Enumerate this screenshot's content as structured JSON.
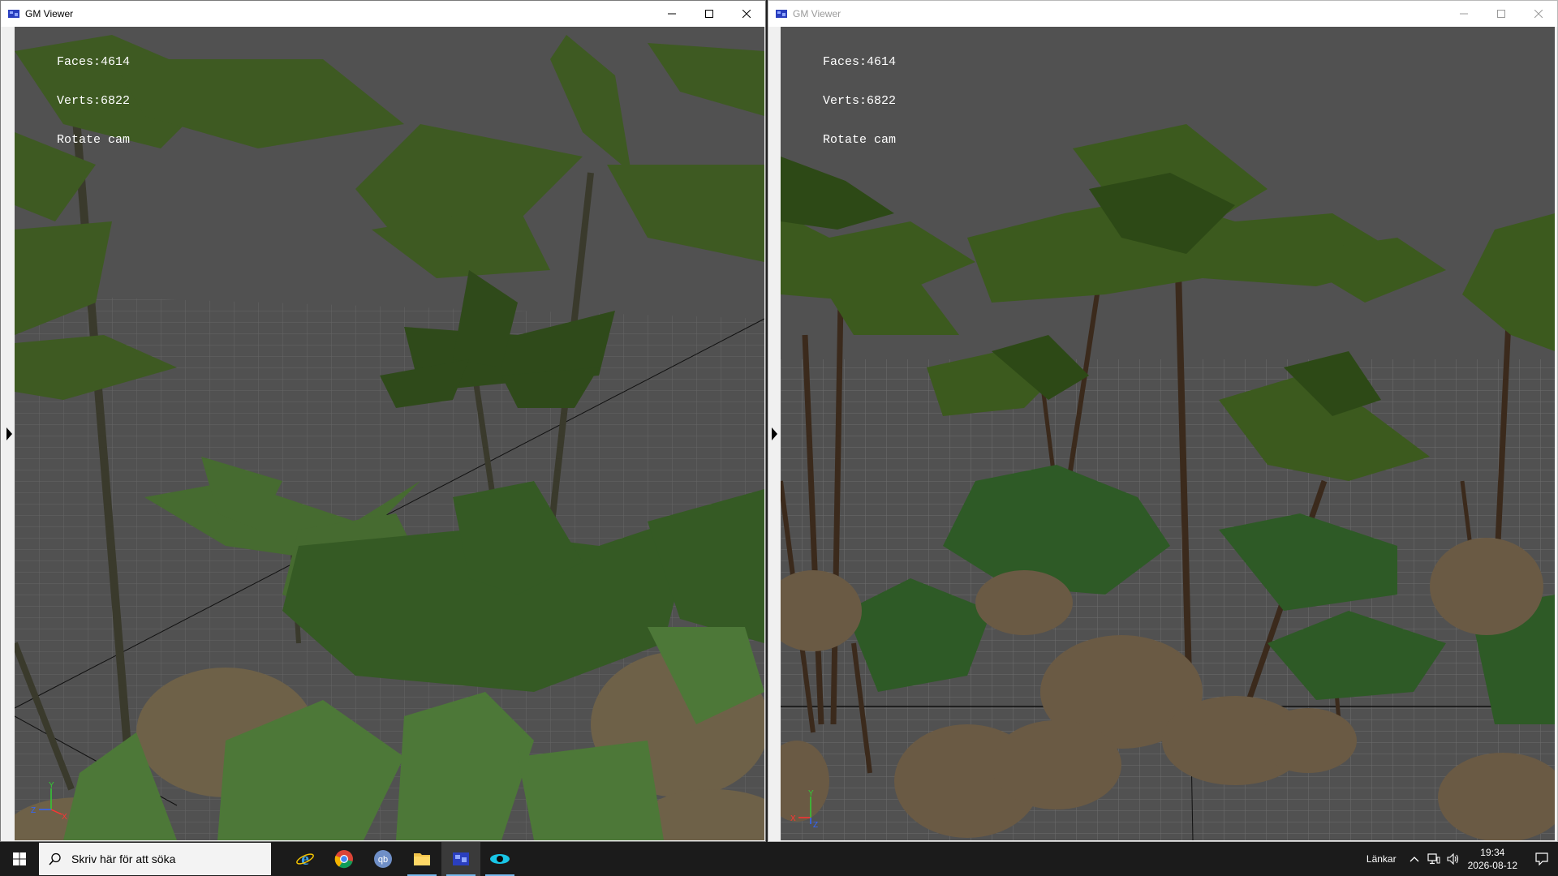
{
  "left_window": {
    "title": "GM Viewer",
    "stats": {
      "faces": "Faces:4614",
      "verts": "Verts:6822",
      "mode": "Rotate cam"
    },
    "axes": {
      "y": "Y",
      "z": "Z",
      "x": "X"
    }
  },
  "right_window": {
    "title": "GM Viewer",
    "stats": {
      "faces": "Faces:4614",
      "verts": "Verts:6822",
      "mode": "Rotate cam"
    },
    "axes": {
      "y": "Y",
      "x": "X",
      "z": "Z"
    }
  },
  "taskbar": {
    "search_placeholder": "Skriv här för att söka",
    "apps": [
      "internet-explorer",
      "chrome",
      "qbittorrent",
      "file-explorer",
      "gm-viewer",
      "eye-app"
    ],
    "links_label": "Länkar",
    "time": "19:34",
    "date": "2026-08-12"
  },
  "colors": {
    "viewport_bg": "#515151",
    "leaf_dark": "#2e4a1e",
    "leaf_mid": "#4b6b2c",
    "rock": "#6e6148",
    "axis_x": "#ff3333",
    "axis_y": "#33cc33",
    "axis_z": "#3366ff",
    "taskbar_bg": "#1b1b1b"
  }
}
